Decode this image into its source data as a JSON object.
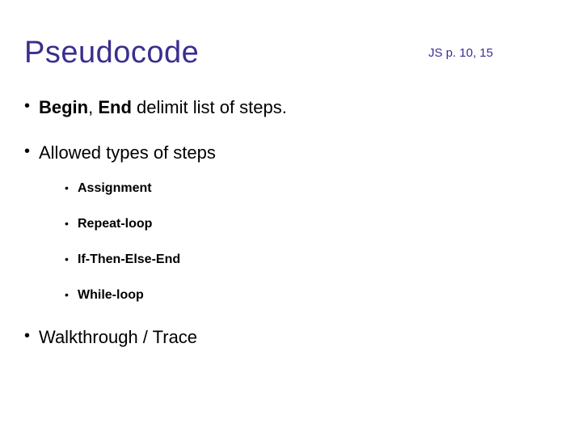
{
  "title": "Pseudocode",
  "reference": "JS p. 10, 15",
  "bullets": {
    "b1_bold1": "Begin",
    "b1_sep": ", ",
    "b1_bold2": "End",
    "b1_rest": " delimit list of steps.",
    "b2": "Allowed types of steps",
    "b2_sub": {
      "s1": "Assignment",
      "s2": "Repeat-loop",
      "s3": "If-Then-Else-End",
      "s4": "While-loop"
    },
    "b3": "Walkthrough / Trace"
  }
}
